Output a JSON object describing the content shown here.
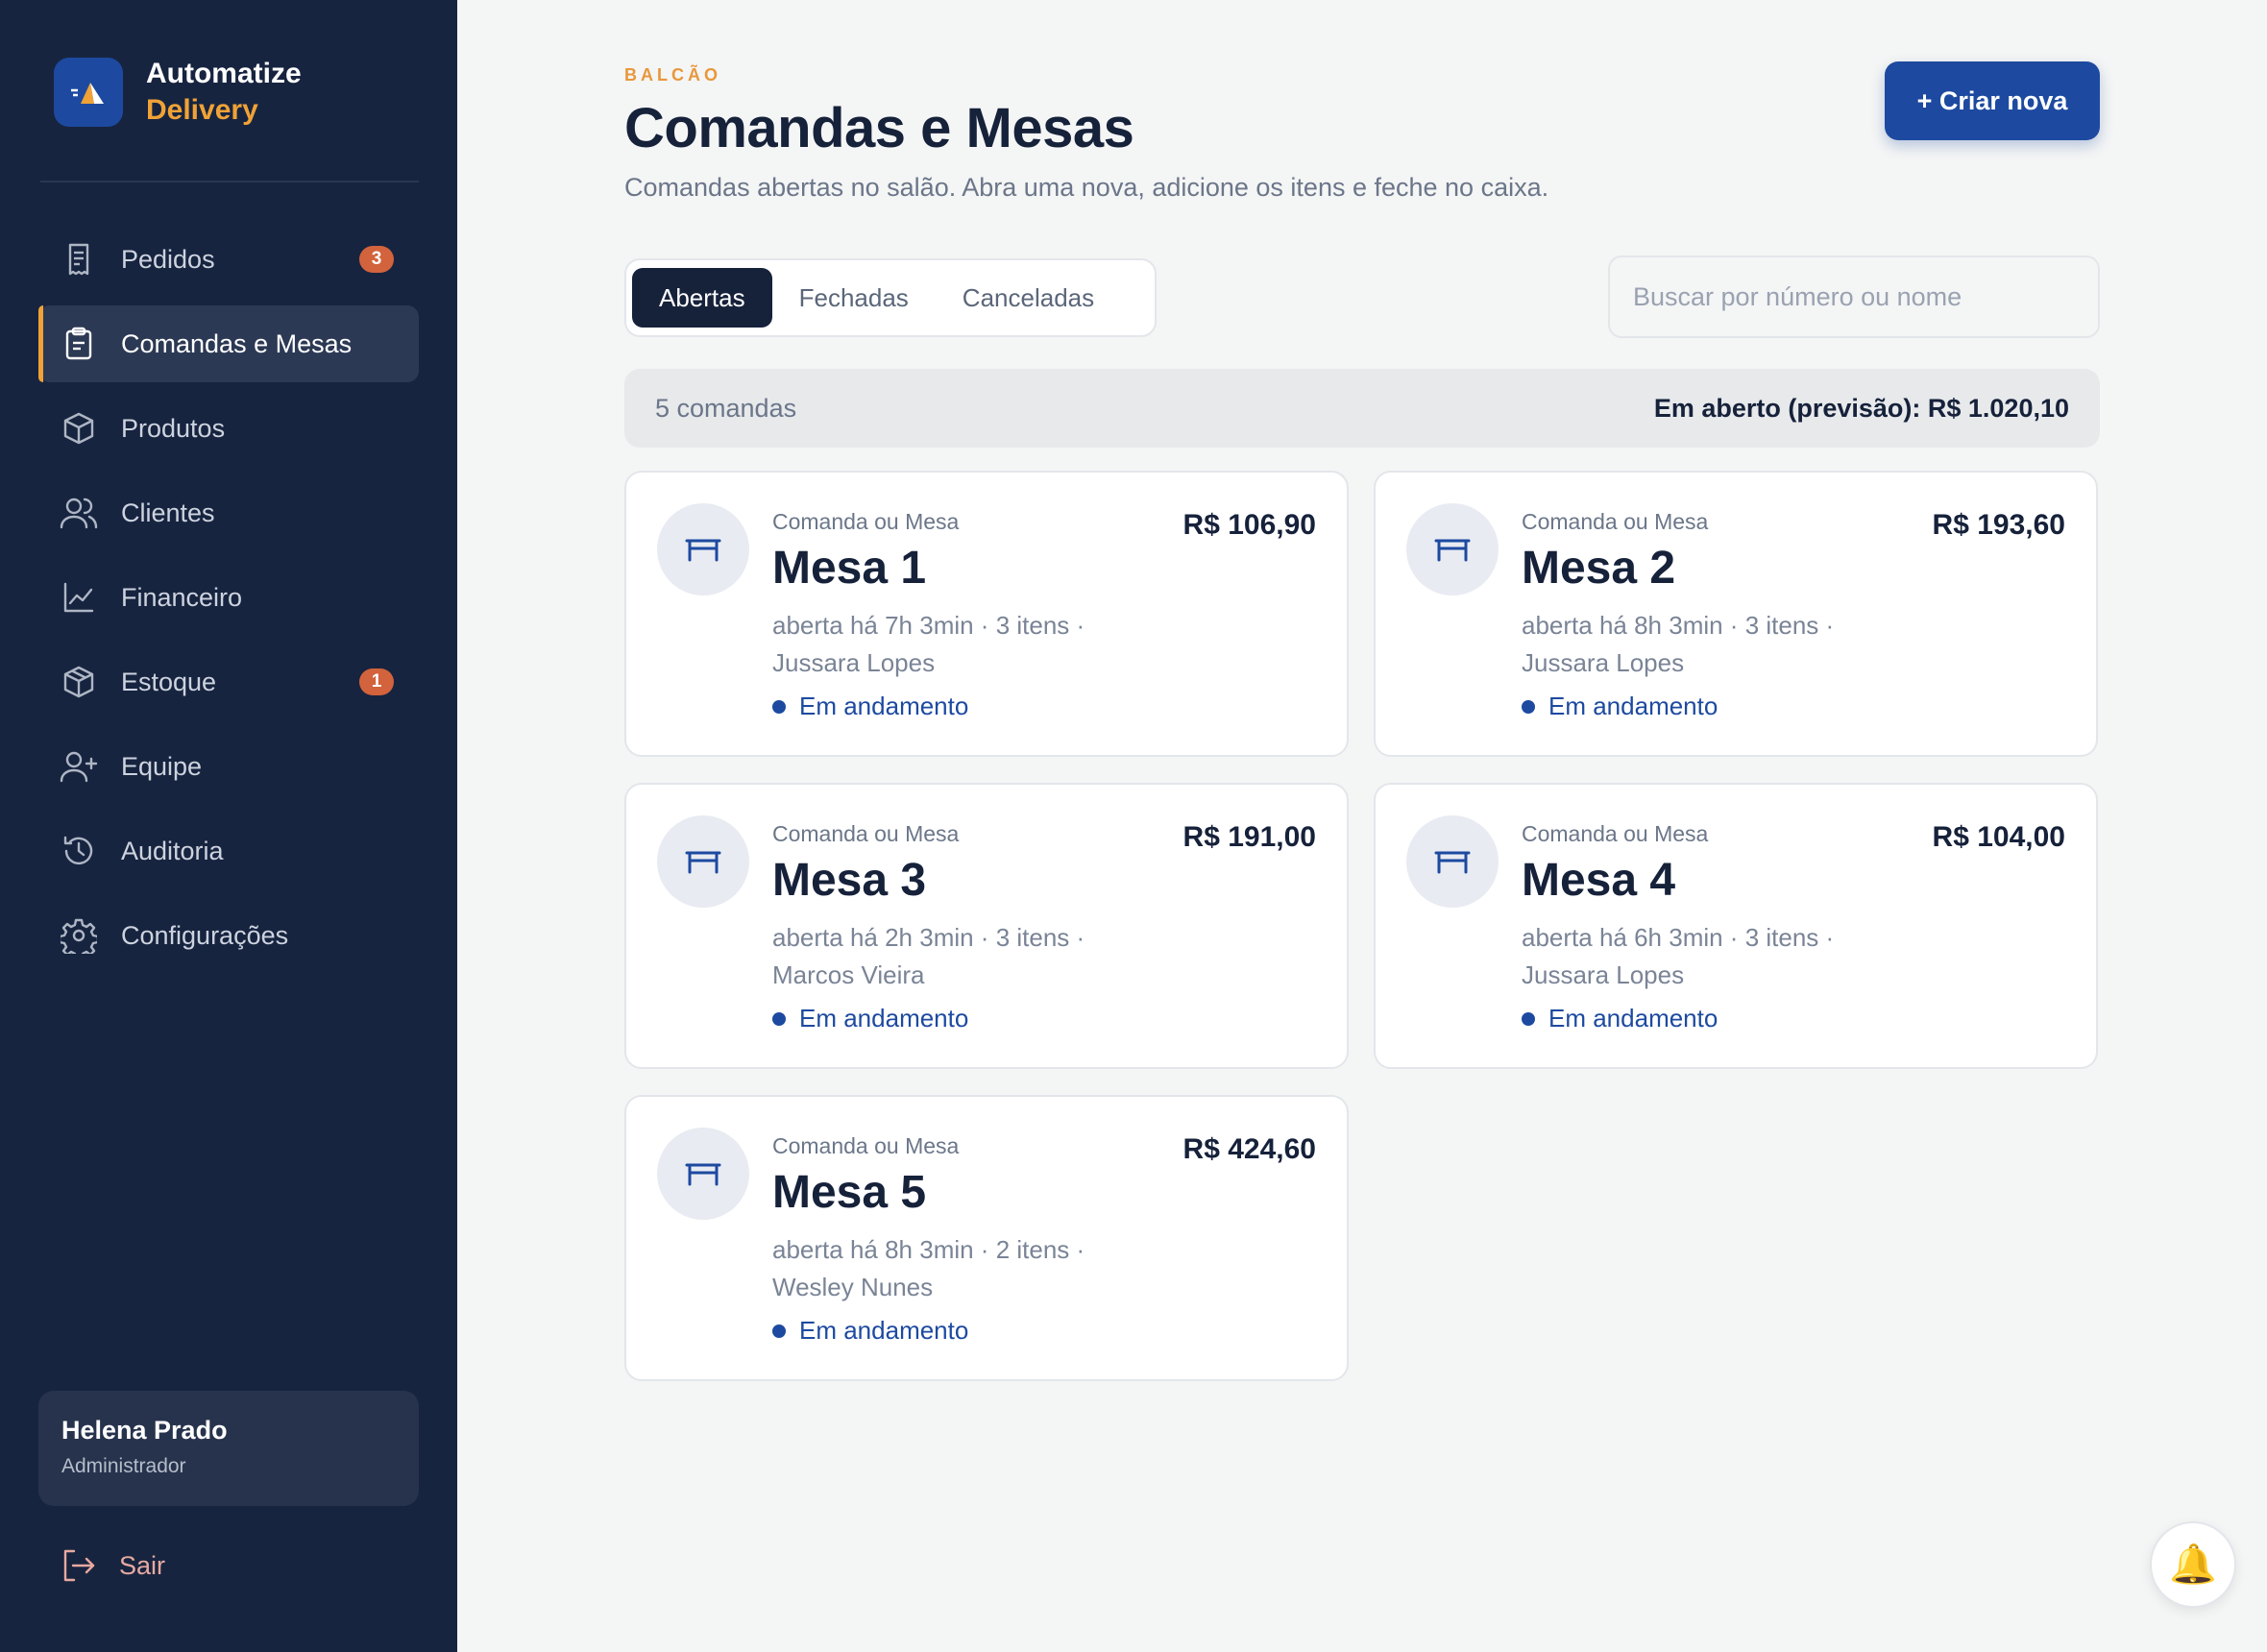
{
  "brand": {
    "name": "Automatize",
    "sub": "Delivery"
  },
  "nav": {
    "items": [
      {
        "label": "Pedidos",
        "icon": "receipt-icon",
        "badge": "3"
      },
      {
        "label": "Comandas e Mesas",
        "icon": "clipboard-icon",
        "active": true
      },
      {
        "label": "Produtos",
        "icon": "box-icon"
      },
      {
        "label": "Clientes",
        "icon": "users-icon"
      },
      {
        "label": "Financeiro",
        "icon": "chart-line-icon"
      },
      {
        "label": "Estoque",
        "icon": "package-icon",
        "badge": "1"
      },
      {
        "label": "Equipe",
        "icon": "user-plus-icon"
      },
      {
        "label": "Auditoria",
        "icon": "history-icon"
      },
      {
        "label": "Configurações",
        "icon": "gear-icon"
      }
    ]
  },
  "user": {
    "name": "Helena Prado",
    "role": "Administrador"
  },
  "logout": {
    "label": "Sair",
    "icon": "logout-icon"
  },
  "header": {
    "eyebrow": "BALCÃO",
    "title": "Comandas e Mesas",
    "subtitle": "Comandas abertas no salão. Abra uma nova, adicione os itens e feche no caixa.",
    "create_label": "+ Criar nova"
  },
  "tabs": [
    {
      "label": "Abertas",
      "active": true
    },
    {
      "label": "Fechadas"
    },
    {
      "label": "Canceladas"
    }
  ],
  "search": {
    "placeholder": "Buscar por número ou nome",
    "value": ""
  },
  "summary": {
    "count": "5 comandas",
    "total": "Em aberto (previsão): R$ 1.020,10"
  },
  "cards": [
    {
      "kicker": "Comanda ou Mesa",
      "title": "Mesa 1",
      "meta": "aberta há 7h 3min · 3 itens ·",
      "customer": "Jussara Lopes",
      "price": "R$ 106,90",
      "status": "Em andamento",
      "icon": "table-icon"
    },
    {
      "kicker": "Comanda ou Mesa",
      "title": "Mesa 2",
      "meta": "aberta há 8h 3min · 3 itens ·",
      "customer": "Jussara Lopes",
      "price": "R$ 193,60",
      "status": "Em andamento",
      "icon": "table-icon"
    },
    {
      "kicker": "Comanda ou Mesa",
      "title": "Mesa 3",
      "meta": "aberta há 2h 3min · 3 itens ·",
      "customer": "Marcos Vieira",
      "price": "R$ 191,00",
      "status": "Em andamento",
      "icon": "table-icon"
    },
    {
      "kicker": "Comanda ou Mesa",
      "title": "Mesa 4",
      "meta": "aberta há 6h 3min · 3 itens ·",
      "customer": "Jussara Lopes",
      "price": "R$ 104,00",
      "status": "Em andamento",
      "icon": "table-icon"
    },
    {
      "kicker": "Comanda ou Mesa",
      "title": "Mesa 5",
      "meta": "aberta há 8h 3min · 2 itens ·",
      "customer": "Wesley Nunes",
      "price": "R$ 424,60",
      "status": "Em andamento",
      "icon": "table-icon"
    }
  ],
  "notifications": {
    "icon": "bell-icon",
    "glyph": "🔔"
  },
  "colors": {
    "sidebar": "#172440",
    "accent": "#1d4aa0",
    "brand_orange": "#f0a236",
    "badge": "#d2633c"
  }
}
